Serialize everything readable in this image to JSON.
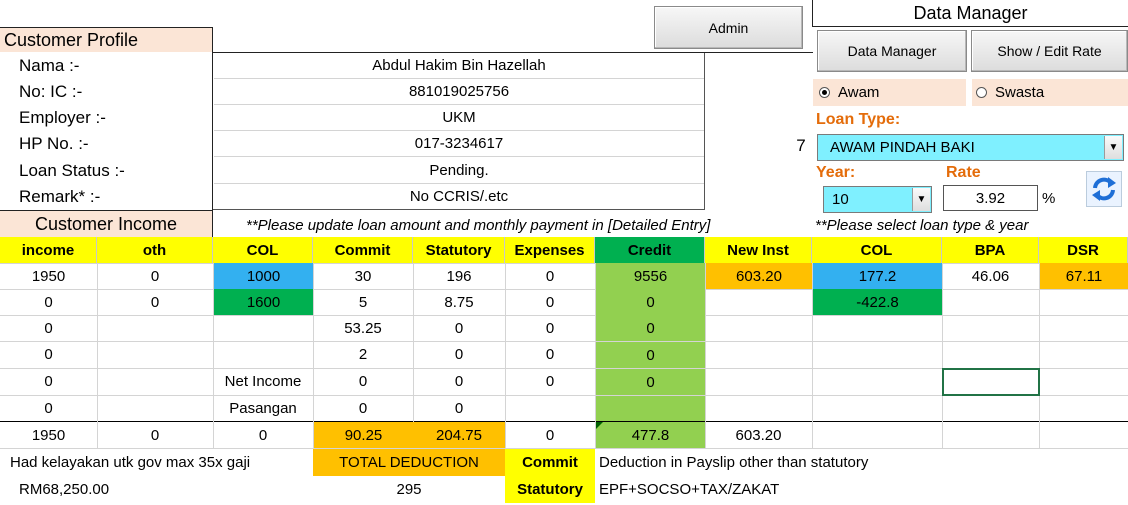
{
  "profile": {
    "title": "Customer Profile",
    "fields": [
      {
        "label": "Nama :-",
        "value": "Abdul Hakim Bin Hazellah"
      },
      {
        "label": "No: IC :-",
        "value": "881019025756"
      },
      {
        "label": "Employer :-",
        "value": "UKM"
      },
      {
        "label": "HP No. :-",
        "value": "017-3234617"
      },
      {
        "label": "Loan Status :-",
        "value": "Pending."
      },
      {
        "label": "Remark* :-",
        "value": "No CCRIS/.etc"
      }
    ],
    "side_number": "7"
  },
  "admin_button": "Admin",
  "manager": {
    "title": "Data Manager",
    "data_manager_button": "Data Manager",
    "show_edit_rate_button": "Show / Edit Rate",
    "radio_awam": "Awam",
    "radio_swasta": "Swasta",
    "loan_type_label": "Loan Type:",
    "loan_type_value": "AWAM PINDAH BAKI",
    "year_label": "Year:",
    "rate_label": "Rate",
    "year_value": "10",
    "rate_value": "3.92",
    "percent": "%",
    "note": "**Please select loan type & year"
  },
  "income": {
    "title": "Customer Income",
    "note": "**Please update loan amount and monthly payment in [Detailed Entry]"
  },
  "table": {
    "headers": [
      "income",
      "oth",
      "COL",
      "Commit",
      "Statutory",
      "Expenses",
      "Credit",
      "New Inst",
      "COL",
      "BPA",
      "DSR"
    ],
    "rows": [
      [
        "1950",
        "0",
        "1000",
        "30",
        "196",
        "0",
        "9556",
        "603.20",
        "177.2",
        "46.06",
        "67.11"
      ],
      [
        "0",
        "0",
        "1600",
        "5",
        "8.75",
        "0",
        "0",
        "",
        "-422.8",
        "",
        ""
      ],
      [
        "0",
        "",
        "",
        "53.25",
        "0",
        "0",
        "0",
        "",
        "",
        "",
        ""
      ],
      [
        "0",
        "",
        "",
        "2",
        "0",
        "0",
        "0",
        "",
        "",
        "",
        ""
      ],
      [
        "0",
        "",
        "Net Income",
        "0",
        "0",
        "0",
        "0",
        "",
        "",
        "",
        ""
      ],
      [
        "0",
        "",
        "Pasangan",
        "0",
        "0",
        "",
        "",
        "",
        "",
        "",
        ""
      ],
      [
        "1950",
        "0",
        "0",
        "90.25",
        "204.75",
        "0",
        "477.8",
        "603.20",
        "",
        "",
        ""
      ]
    ]
  },
  "footer": {
    "had_label": "Had kelayakan utk gov max 35x gaji",
    "had_value": "RM68,250.00",
    "total_deduction_label": "TOTAL DEDUCTION",
    "total_deduction_value": "295",
    "commit_label": "Commit",
    "commit_desc": "Deduction in Payslip other than statutory",
    "statutory_label": "Statutory",
    "statutory_desc": "EPF+SOCSO+TAX/ZAKAT"
  },
  "colors": {
    "yellow": "#ffff00",
    "blue": "#33b0f0",
    "green": "#00b050",
    "light_green": "#92d050",
    "orange": "#ffc000",
    "peach": "#fbe5d6",
    "loan_type_orange": "#e46c0a",
    "cyan": "#7ff0ff"
  }
}
